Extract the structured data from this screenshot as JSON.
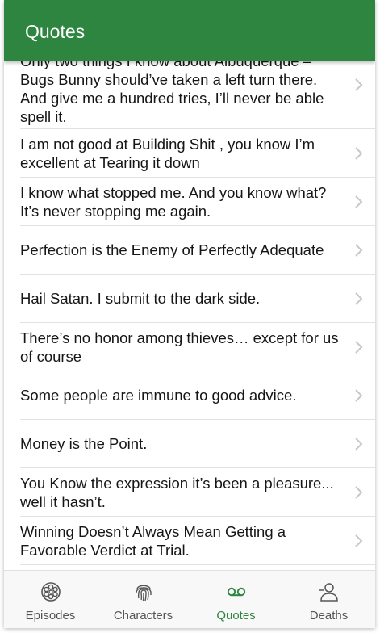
{
  "header": {
    "title": "Quotes"
  },
  "quotes": [
    "Only two things I know about Albuquerque – Bugs Bunny should’ve taken a left turn there. And give me a hundred tries, I’ll never be able spell it.",
    "I am not good at Building Shit , you know I’m excellent at Tearing it down",
    "I know what stopped me. And you know what? It’s never stopping me again.",
    "Perfection is the Enemy of Perfectly Adequate",
    "Hail Satan. I submit to the dark side.",
    "There’s no honor among thieves… except for us of course",
    "Some people are immune to good advice.",
    "Money is the Point.",
    "You Know the expression it’s been a pleasure... well it hasn’t.",
    "Winning Doesn’t Always Mean Getting a Favorable Verdict at Trial."
  ],
  "tabs": [
    {
      "label": "Episodes",
      "icon": "film-reel-icon",
      "active": false
    },
    {
      "label": "Characters",
      "icon": "fingerprint-icon",
      "active": false
    },
    {
      "label": "Quotes",
      "icon": "voicemail-icon",
      "active": true
    },
    {
      "label": "Deaths",
      "icon": "person-minus-icon",
      "active": false
    }
  ],
  "colors": {
    "primary": "#2e8540",
    "inactive": "#555555",
    "chevron": "#c7c7cc"
  }
}
